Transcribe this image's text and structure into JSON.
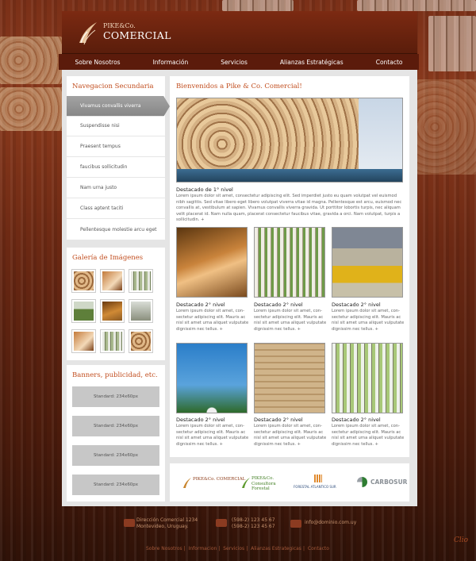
{
  "brand": {
    "small": "PIKE&Co.",
    "big": "COMERCIAL"
  },
  "nav": [
    "Sobre Nosotros",
    "Información",
    "Servicios",
    "Alianzas Estratégicas",
    "Contacto"
  ],
  "sidebar": {
    "secondary_title": "Navegacion Secundaria",
    "items": [
      "Vivamus convallis viverra",
      "Suspendisse nisi",
      "Praesent tempus",
      "faucibus sollicitudin",
      "Nam urna justo",
      "Class aptent taciti",
      "Pellentesque molestie arcu eget"
    ],
    "gallery_title": "Galería de Imágenes",
    "banners_title": "Banners, publicidad, etc.",
    "banners": [
      "Standard: 234x60px",
      "Standard: 234x60px",
      "Standard: 234x60px",
      "Standard: 234x60px"
    ]
  },
  "main": {
    "title": "Bienvenidos a Pike & Co. Comercial!",
    "hero_caption": "Destacado de 1° nivel",
    "hero_text": "Lorem ipsum dolor sit amet, consectetur adipiscing elit. Sed imperdiet justo eu quam volutpat vel euismod nibh sagittis. Sed vitae libero eget libero volutpat viverra vitae id magna. Pellentesque est arcu, euismod nec convallis at, vestibulum at sapien. Vivamus convallis viverra gravida. Ut porttitor lobortis turpis, nec aliquam velit placerat id. Nam nulla quam, placerat consectetur faucibus vitae, gravida a orci. Nam volutpat, turpis a sollicitudin. +",
    "secondary_caption": "Destacado 2° nivel",
    "secondary_text": "Lorem ipsum dolor sit amet, con-sectetur adipiscing elit. Mauris ac nisl sit amet urna aliquet vulputate dignissim nec tellus. +"
  },
  "partners": [
    "PIKE&Co. COMERCIAL",
    "PIKE&Co. Consultora Forestal",
    "FORESTAL ATLANTICO SUR",
    "CARBOSUR"
  ],
  "footer": {
    "address_1": "Dirección Comercial 1234",
    "address_2": "Montevideo, Uruguay.",
    "phone_1": "(598-2) 123 45 67",
    "phone_2": "(598-2) 123 45 67",
    "email": "info@dominio.com.uy",
    "nav": [
      "Sobre Nosotros",
      "Informacion",
      "Servicios",
      "Alianzas Estrategicas",
      "Contacto"
    ]
  },
  "signature": "Clio"
}
